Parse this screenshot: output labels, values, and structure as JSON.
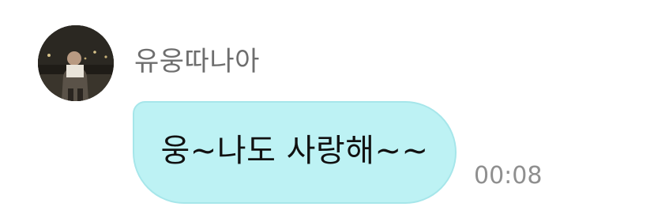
{
  "message": {
    "sender_name": "유웅따나아",
    "avatar_icon": "profile-photo-icon",
    "text": "웅~나도 사랑해~~",
    "time": "00:08",
    "bubble_color": "#bdf2f4"
  }
}
